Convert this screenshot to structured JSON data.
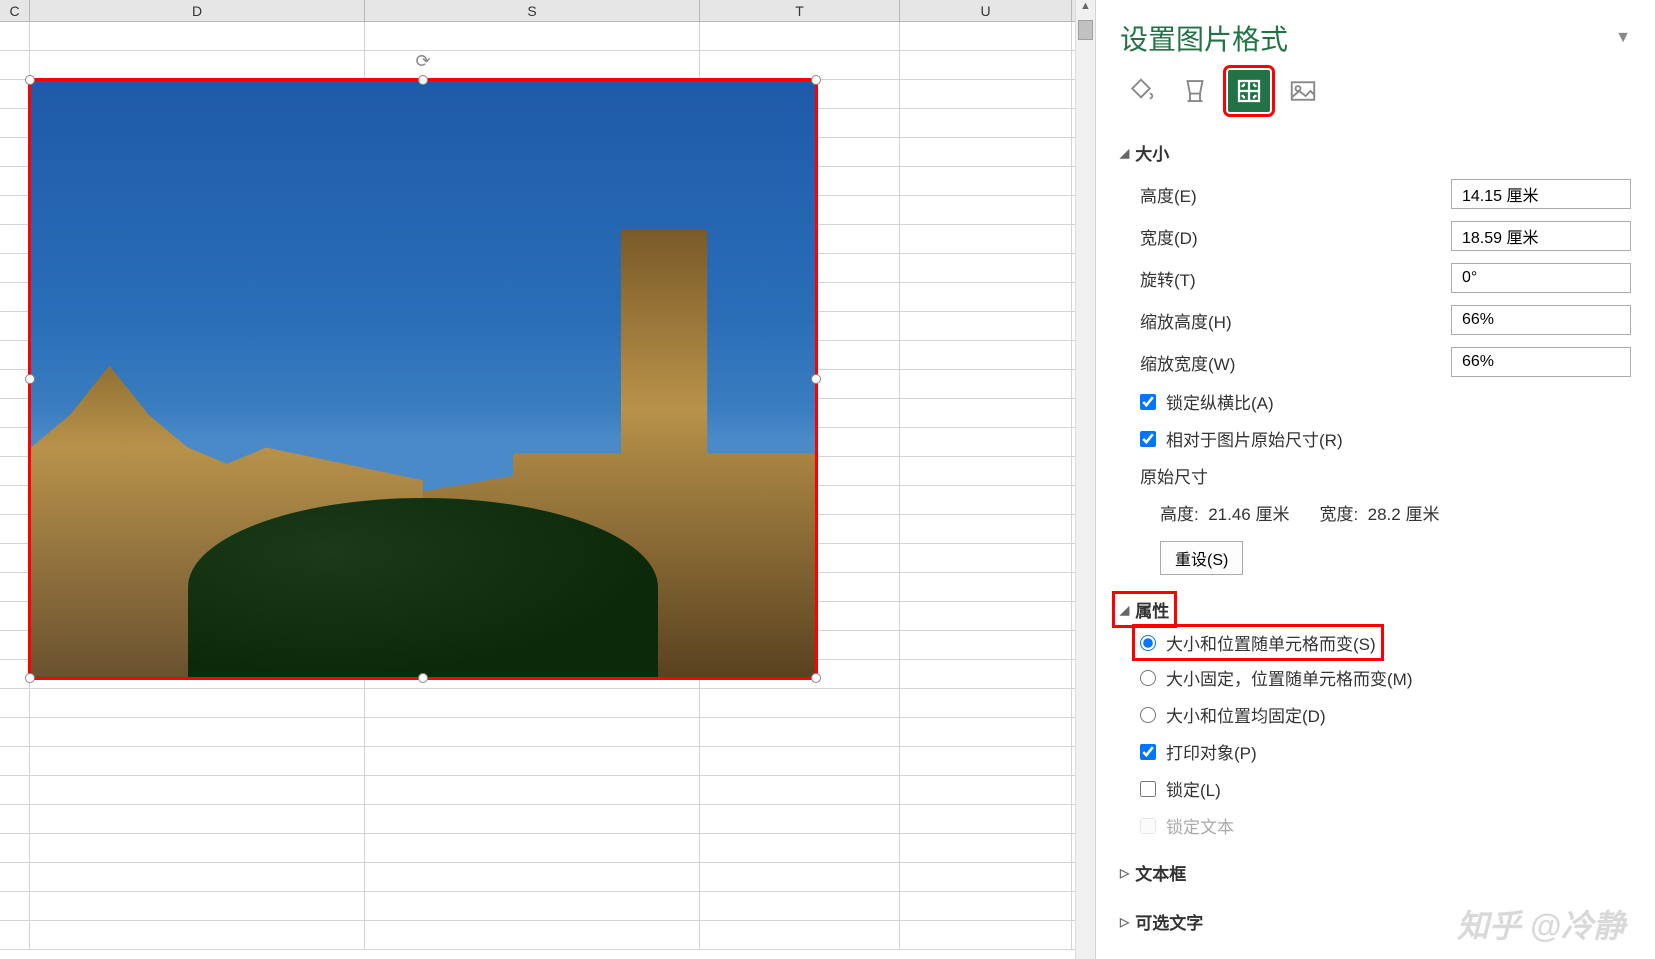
{
  "columns": [
    "C",
    "D",
    "S",
    "T",
    "U"
  ],
  "pane": {
    "title": "设置图片格式",
    "icons": [
      "fill-icon",
      "effects-icon",
      "size-icon",
      "picture-icon"
    ],
    "active_icon_index": 2,
    "sections": {
      "size": {
        "title": "大小",
        "height_label": "高度(E)",
        "height_value": "14.15 厘米",
        "width_label": "宽度(D)",
        "width_value": "18.59 厘米",
        "rotation_label": "旋转(T)",
        "rotation_value": "0°",
        "scale_h_label": "缩放高度(H)",
        "scale_h_value": "66%",
        "scale_w_label": "缩放宽度(W)",
        "scale_w_value": "66%",
        "lock_aspect": "锁定纵横比(A)",
        "relative_orig": "相对于图片原始尺寸(R)",
        "original_size_label": "原始尺寸",
        "orig_h_label": "高度:",
        "orig_h_value": "21.46 厘米",
        "orig_w_label": "宽度:",
        "orig_w_value": "28.2 厘米",
        "reset_label": "重设(S)"
      },
      "properties": {
        "title": "属性",
        "opt_move_size": "大小和位置随单元格而变(S)",
        "opt_move_only": "大小固定，位置随单元格而变(M)",
        "opt_none": "大小和位置均固定(D)",
        "print_obj": "打印对象(P)",
        "locked": "锁定(L)",
        "lock_text": "锁定文本"
      },
      "textbox": {
        "title": "文本框"
      },
      "alttext": {
        "title": "可选文字"
      }
    }
  },
  "watermark": "知乎 @冷静"
}
